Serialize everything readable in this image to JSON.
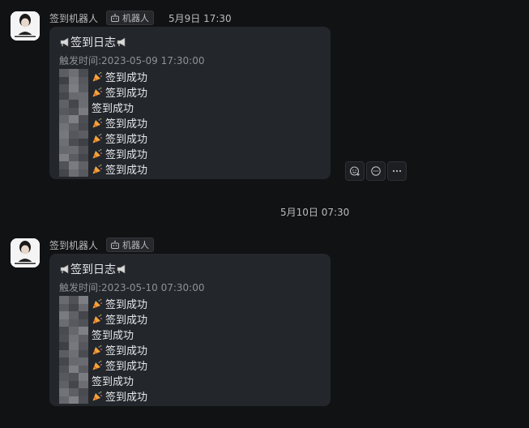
{
  "messages": [
    {
      "sender": "签到机器人",
      "tag": "机器人",
      "time": "5月9日 17:30",
      "title": "签到日志",
      "trigger": "触发时间:2023-05-09 17:30:00",
      "entries": [
        {
          "text": "签到成功",
          "party": true
        },
        {
          "text": "签到成功",
          "party": true
        },
        {
          "text": "签到成功",
          "party": false
        },
        {
          "text": "签到成功",
          "party": true
        },
        {
          "text": "签到成功",
          "party": true
        },
        {
          "text": "签到成功",
          "party": true
        },
        {
          "text": "签到成功",
          "party": true
        }
      ]
    },
    {
      "sender": "签到机器人",
      "tag": "机器人",
      "time": "",
      "title": "签到日志",
      "trigger": "触发时间:2023-05-10 07:30:00",
      "entries": [
        {
          "text": "签到成功",
          "party": true
        },
        {
          "text": "签到成功",
          "party": true
        },
        {
          "text": "签到成功",
          "party": false
        },
        {
          "text": "签到成功",
          "party": true
        },
        {
          "text": "签到成功",
          "party": true
        },
        {
          "text": "签到成功",
          "party": false
        },
        {
          "text": "签到成功",
          "party": true
        }
      ]
    }
  ],
  "divider": {
    "time": "5月10日 07:30"
  },
  "toolbar_icons": [
    "add-reaction-icon",
    "reply-icon",
    "more-icon"
  ],
  "colors": {
    "background": "#111214",
    "bubble": "#23262b",
    "muted_text": "#8e9297"
  }
}
